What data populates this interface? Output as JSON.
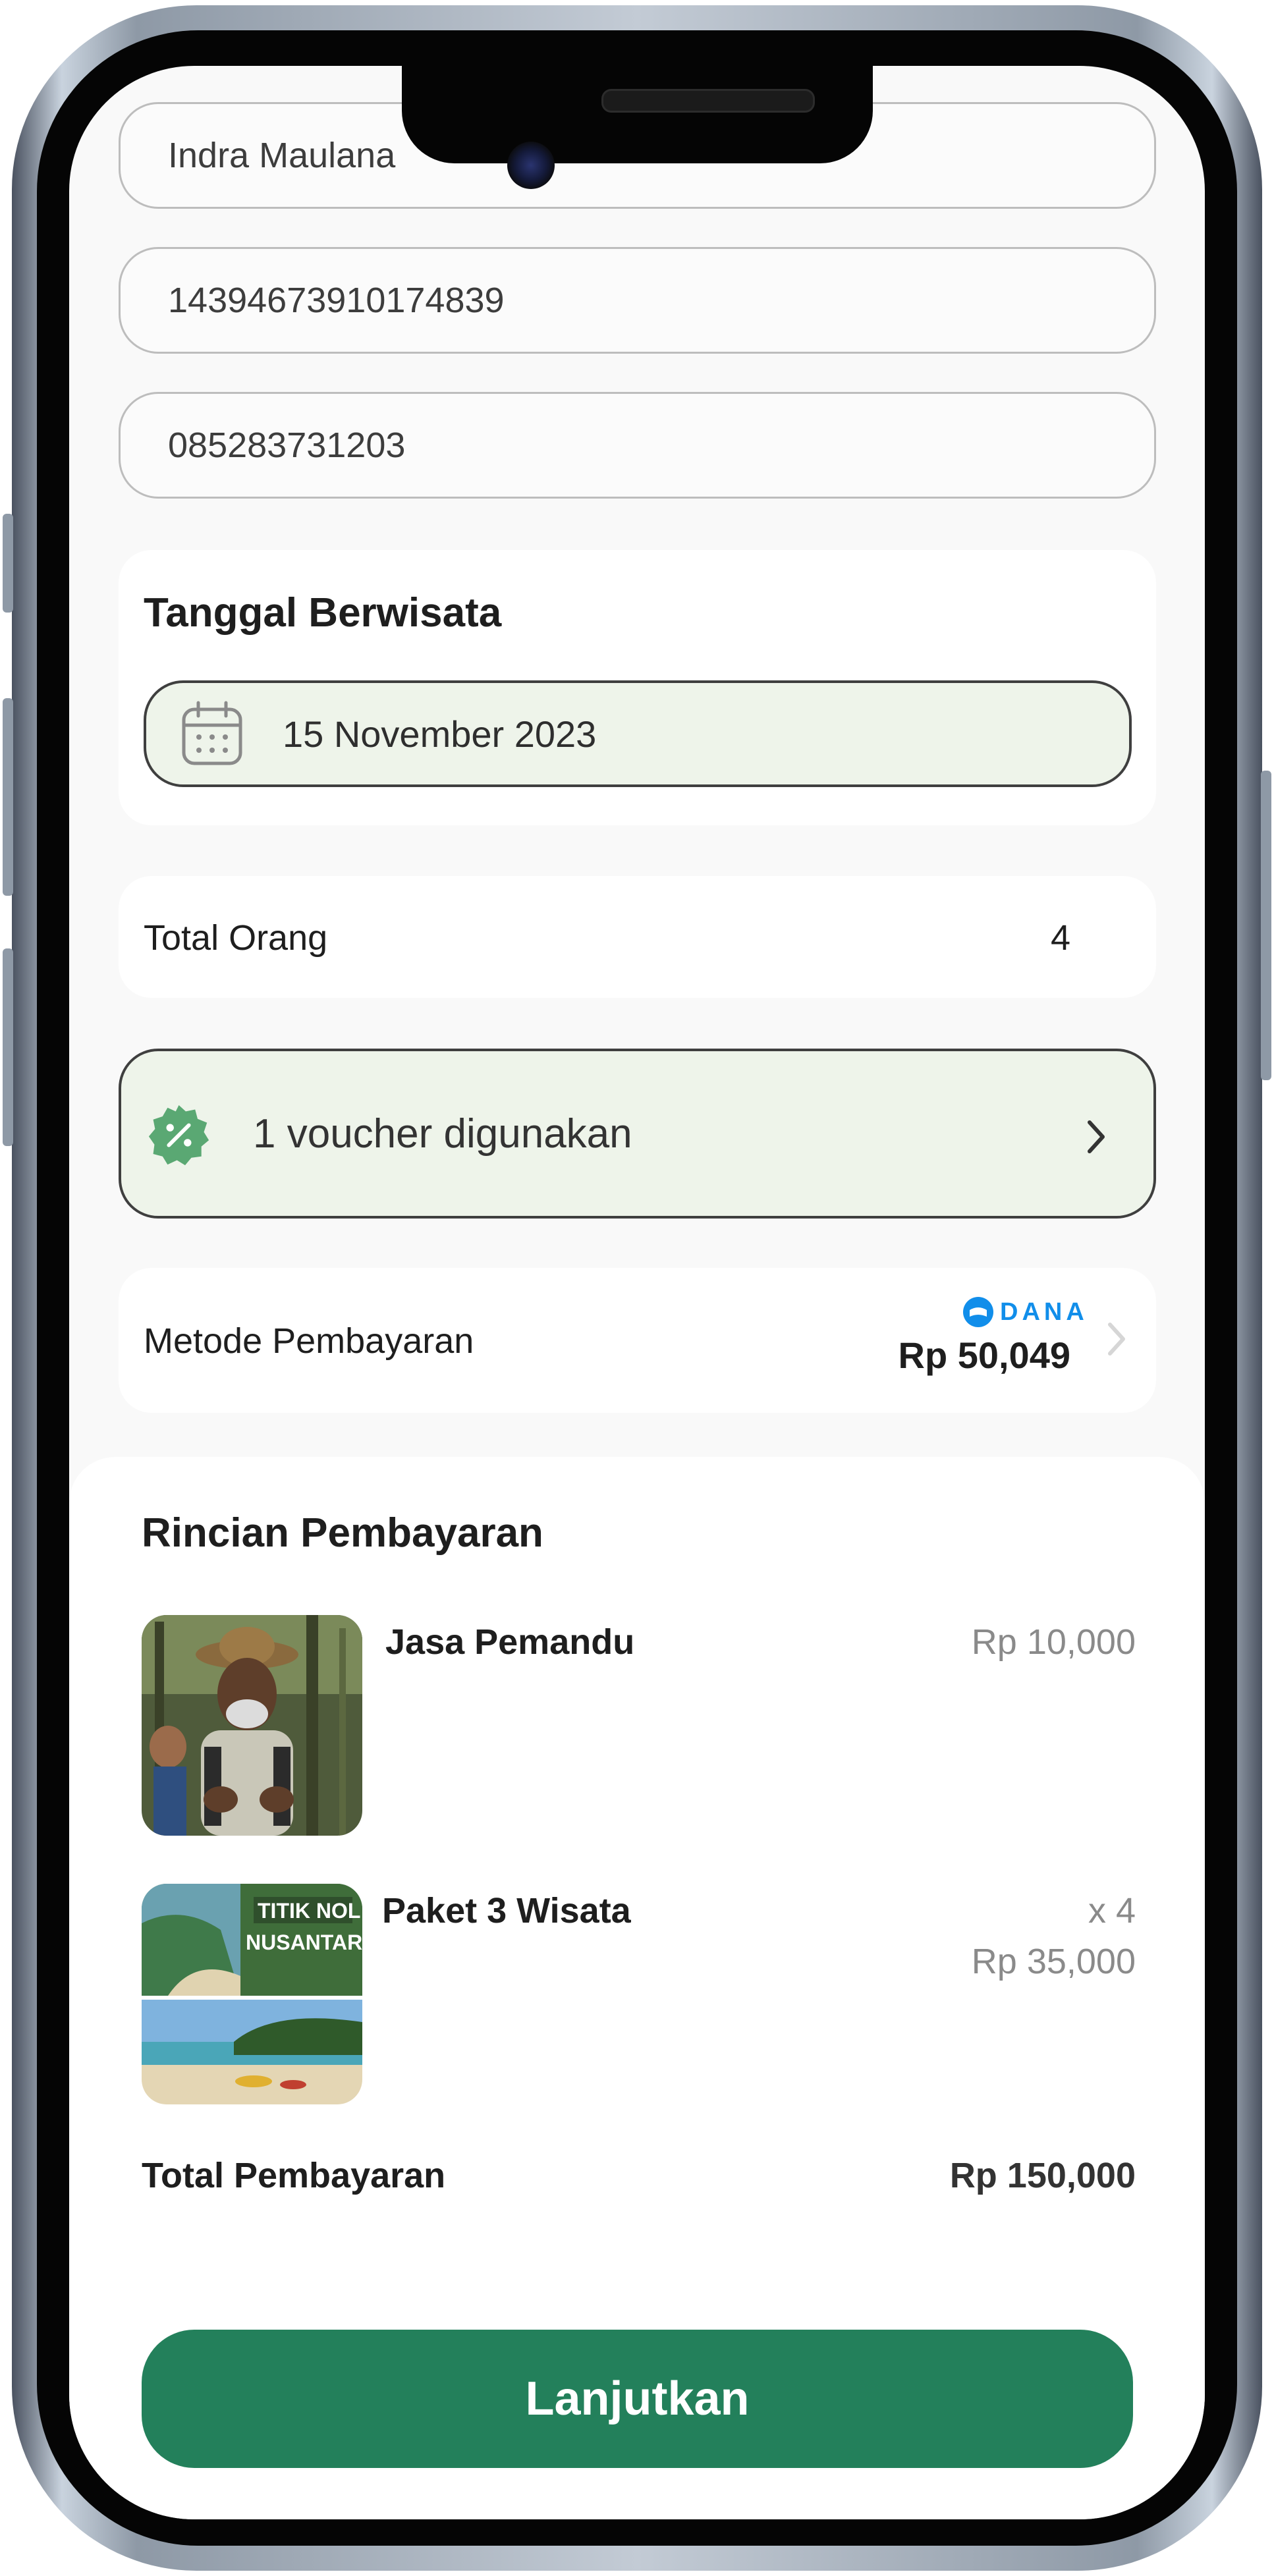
{
  "form": {
    "name_value": "Indra Maulana",
    "id_value": "14394673910174839",
    "phone_value": "085283731203"
  },
  "visit_date": {
    "title": "Tanggal Berwisata",
    "date_value": "15 November 2023",
    "icon": "calendar-icon"
  },
  "people": {
    "label": "Total Orang",
    "count": "4"
  },
  "voucher": {
    "text": "1 voucher digunakan",
    "icon": "discount-badge-icon",
    "chevron": "chevron-right-icon"
  },
  "payment_method": {
    "label": "Metode Pembayaran",
    "provider_logo": "DANA",
    "balance": "Rp 50,049"
  },
  "details": {
    "title": "Rincian Pembayaran",
    "items": [
      {
        "name": "Jasa Pemandu",
        "price": "Rp 10,000",
        "image": "tour-guide-photo"
      },
      {
        "name": "Paket 3 Wisata",
        "quantity": "x 4",
        "price": "Rp 35,000",
        "image": "beach-package-photo",
        "image_text": "TITIK NOL NUSANTARA"
      }
    ],
    "total_label": "Total Pembayaran",
    "total_value": "Rp 150,000"
  },
  "cta": {
    "label": "Lanjutkan"
  },
  "colors": {
    "primary": "#23805b",
    "voucher_bg": "#eef4ea",
    "dana_blue": "#118eea",
    "badge_green": "#5aa873"
  }
}
